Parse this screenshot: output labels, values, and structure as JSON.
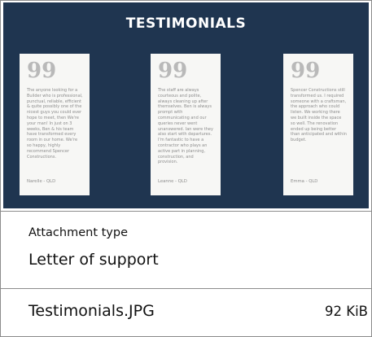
{
  "thumbnail": {
    "heading": "TESTIMONIALS",
    "background": "#1f3550",
    "quote_glyph": "99",
    "testimonials": [
      {
        "text": "The anyone looking for a Builder who is professional, punctual, reliable, efficient & quite possibly one of the nicest guys you could ever hope to meet, then We're your man! In just on 3 weeks, Ben & his team have transformed every room in our home. We're so happy, highly recommend Spencer Constructions.",
        "author": "Narelle - QLD"
      },
      {
        "text": "The staff are always courteous and polite, always cleaning up after themselves. Ben is always prompt with communicating and our queries never went unanswered. Ian were they also start with departures. I'm fantastic to have a contractor who plays an active part in planning, construction, and provision.",
        "author": "Leanne - QLD"
      },
      {
        "text": "Spencer Constructions still transformed us. I required someone with a craftsman, the approach who could listen. We working there we built inside the space so well. The renovation ended up being better than anticipated and within budget.",
        "author": "Emma - QLD"
      }
    ]
  },
  "attachment": {
    "type_label": "Attachment type",
    "type_value": "Letter of support"
  },
  "file": {
    "name": "Testimonials.JPG",
    "size": "92 KiB"
  }
}
